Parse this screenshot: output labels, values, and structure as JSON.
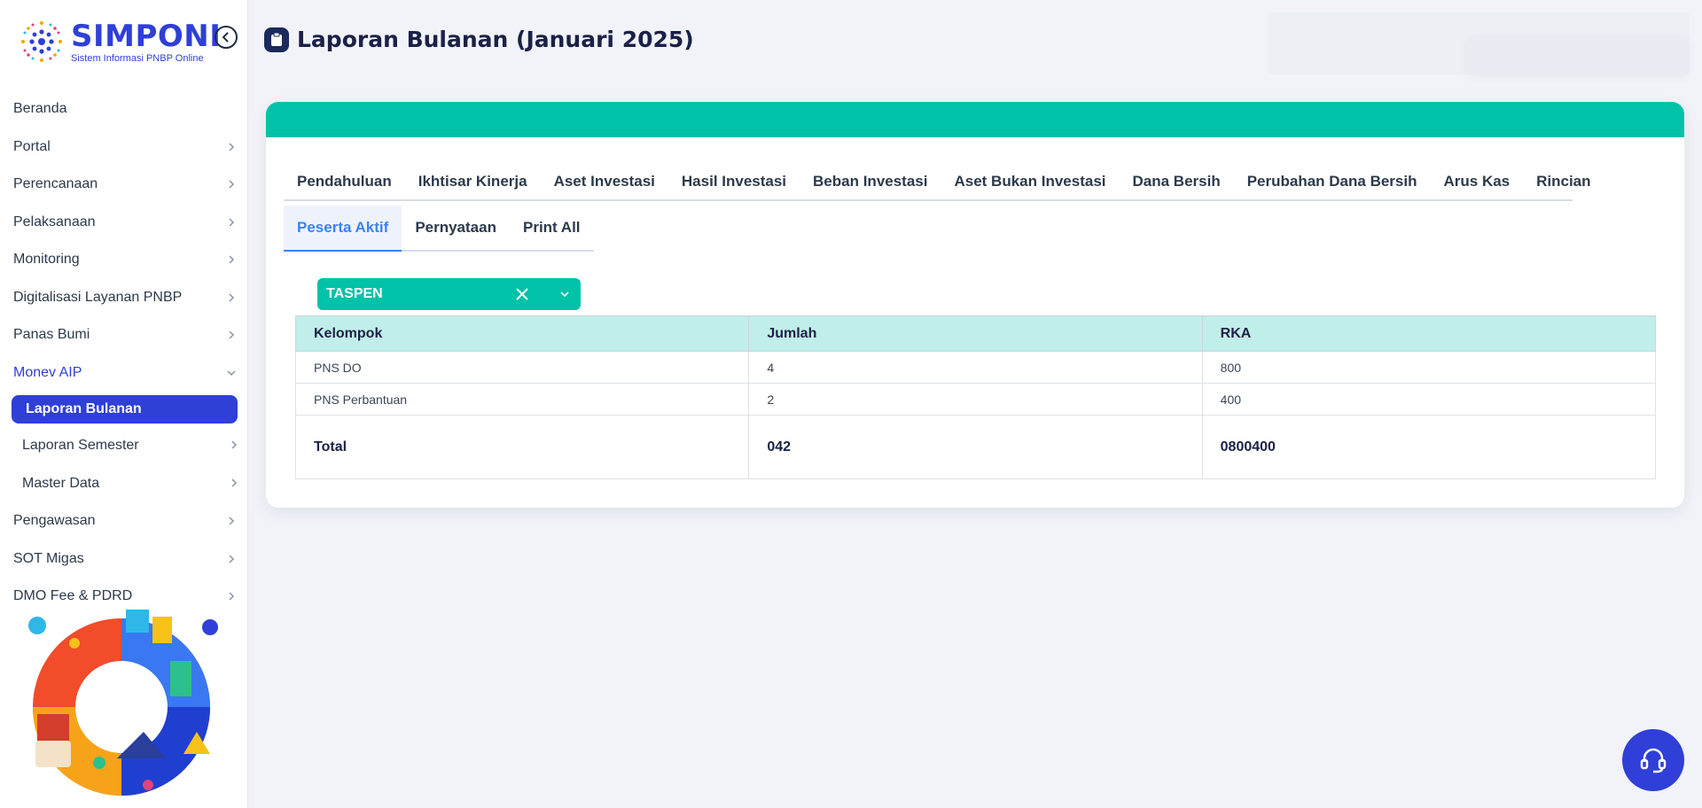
{
  "brand": {
    "name": "SIMPONI",
    "subtitle": "Sistem Informasi PNBP Online"
  },
  "sidebar": {
    "items": [
      {
        "label": "Beranda",
        "icon": "none"
      },
      {
        "label": "Portal",
        "icon": "chevron-right-icon"
      },
      {
        "label": "Perencanaan",
        "icon": "chevron-right-icon"
      },
      {
        "label": "Pelaksanaan",
        "icon": "chevron-right-icon"
      },
      {
        "label": "Monitoring",
        "icon": "chevron-right-icon"
      },
      {
        "label": "Digitalisasi Layanan PNBP",
        "icon": "chevron-right-icon"
      },
      {
        "label": "Panas Bumi",
        "icon": "chevron-right-icon"
      },
      {
        "label": "Monev AIP",
        "icon": "chevron-down-icon",
        "expanded": true
      },
      {
        "label": "Pengawasan",
        "icon": "chevron-right-icon"
      },
      {
        "label": "SOT Migas",
        "icon": "chevron-right-icon"
      },
      {
        "label": "DMO Fee & PDRD",
        "icon": "chevron-right-icon"
      }
    ],
    "subitems": [
      {
        "label": "Laporan Bulanan",
        "active": true
      },
      {
        "label": "Laporan Semester",
        "icon": "chevron-right-icon"
      },
      {
        "label": "Master Data",
        "icon": "chevron-right-icon"
      }
    ]
  },
  "header": {
    "title": "Laporan Bulanan (Januari 2025)"
  },
  "tabs": [
    "Pendahuluan",
    "Ikhtisar Kinerja",
    "Aset Investasi",
    "Hasil Investasi",
    "Beban Investasi",
    "Aset Bukan Investasi",
    "Dana Bersih",
    "Perubahan Dana Bersih",
    "Arus Kas",
    "Rincian"
  ],
  "subtabs": [
    {
      "label": "Peserta Aktif",
      "active": true
    },
    {
      "label": "Pernyataan"
    },
    {
      "label": "Print All"
    }
  ],
  "filter": {
    "selected": "TASPEN"
  },
  "table": {
    "columns": [
      "Kelompok",
      "Jumlah",
      "RKA"
    ],
    "rows": [
      [
        "PNS DO",
        "4",
        "800"
      ],
      [
        "PNS Perbantuan",
        "2",
        "400"
      ]
    ],
    "total": [
      "Total",
      "042",
      "0800400"
    ]
  },
  "colors": {
    "brand": "#2f3fd8",
    "accent": "#00c2a8",
    "table_header": "#c0eee8",
    "active_tab": "#3b82f6"
  }
}
